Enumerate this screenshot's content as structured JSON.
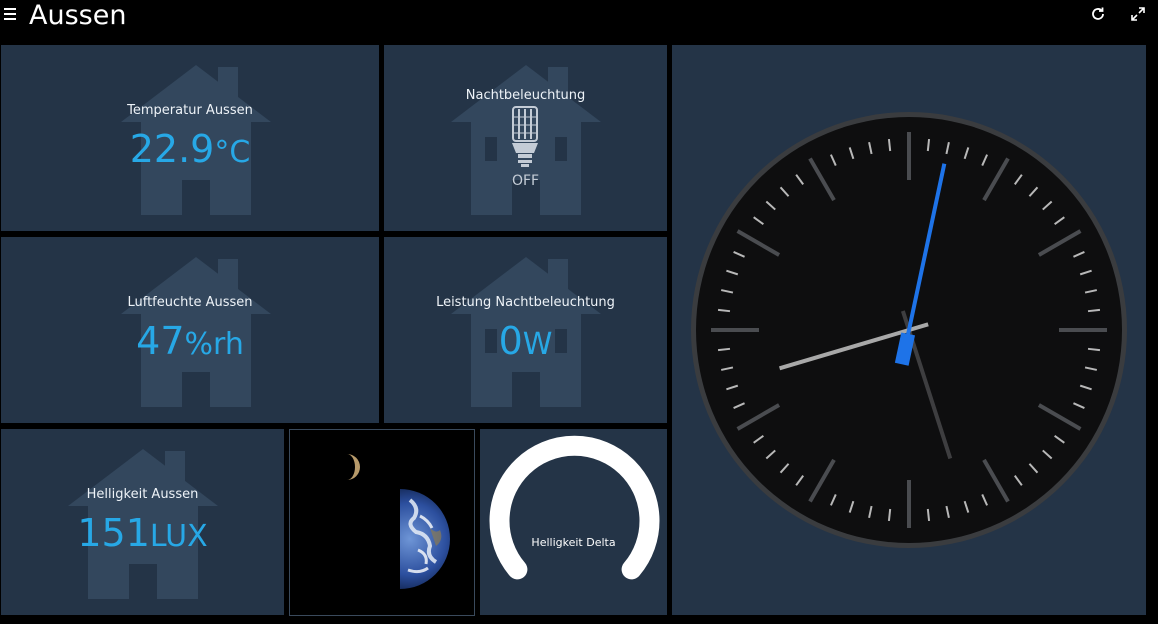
{
  "header": {
    "title": "Aussen",
    "icons": [
      "menu-icon",
      "refresh-icon",
      "fullscreen-icon"
    ]
  },
  "tiles": {
    "temperatur": {
      "label": "Temperatur Aussen",
      "value": "22.9",
      "unit": "°C"
    },
    "nachtbeleuchtung": {
      "label": "Nachtbeleuchtung",
      "state": "OFF",
      "icon": "light-bulb-icon"
    },
    "luftfeuchte": {
      "label": "Luftfeuchte Aussen",
      "value": "47",
      "unit": "%rh"
    },
    "leistung": {
      "label": "Leistung Nachtbeleuchtung",
      "value": "0",
      "unit": "W"
    },
    "helligkeit": {
      "label": "Helligkeit Aussen",
      "value": "151",
      "unit": "LUX"
    },
    "image": {
      "description_icon": "earth-moon-image"
    },
    "gauge": {
      "label": "Helligkeit Delta"
    }
  },
  "clock": {
    "hours": 8,
    "minutes": 27,
    "seconds": 2
  },
  "colors": {
    "tile_bg": "#243447",
    "accent": "#27a8e6",
    "second_hand": "#1e73e8",
    "page_bg": "#000000"
  }
}
